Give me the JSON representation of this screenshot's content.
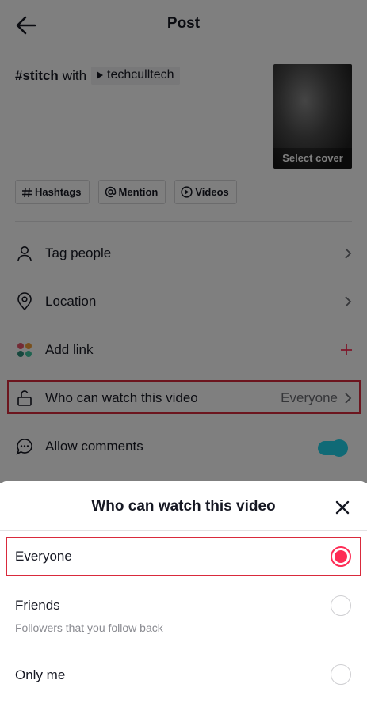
{
  "header": {
    "title": "Post"
  },
  "caption": {
    "hashtag": "#stitch",
    "with": "with",
    "user": "techculltech"
  },
  "cover": {
    "label": "Select cover"
  },
  "chips": [
    {
      "label": "Hashtags",
      "icon": "hash-icon"
    },
    {
      "label": "Mention",
      "icon": "at-icon"
    },
    {
      "label": "Videos",
      "icon": "play-circle-icon"
    }
  ],
  "settings": [
    {
      "label": "Tag people",
      "icon": "person-icon"
    },
    {
      "label": "Location",
      "icon": "location-pin-icon"
    },
    {
      "label": "Add link",
      "icon": "link-dots-icon"
    },
    {
      "label": "Who can watch this video",
      "value": "Everyone",
      "icon": "unlock-icon"
    },
    {
      "label": "Allow comments",
      "icon": "comment-icon",
      "toggle": true
    }
  ],
  "sheet": {
    "title": "Who can watch this video",
    "options": [
      {
        "label": "Everyone",
        "selected": true
      },
      {
        "label": "Friends",
        "subtitle": "Followers that you follow back",
        "selected": false
      },
      {
        "label": "Only me",
        "selected": false
      }
    ]
  },
  "colors": {
    "accent": "#fe2c55",
    "toggle": "#20d5ec",
    "highlight": "#d92a3c"
  }
}
